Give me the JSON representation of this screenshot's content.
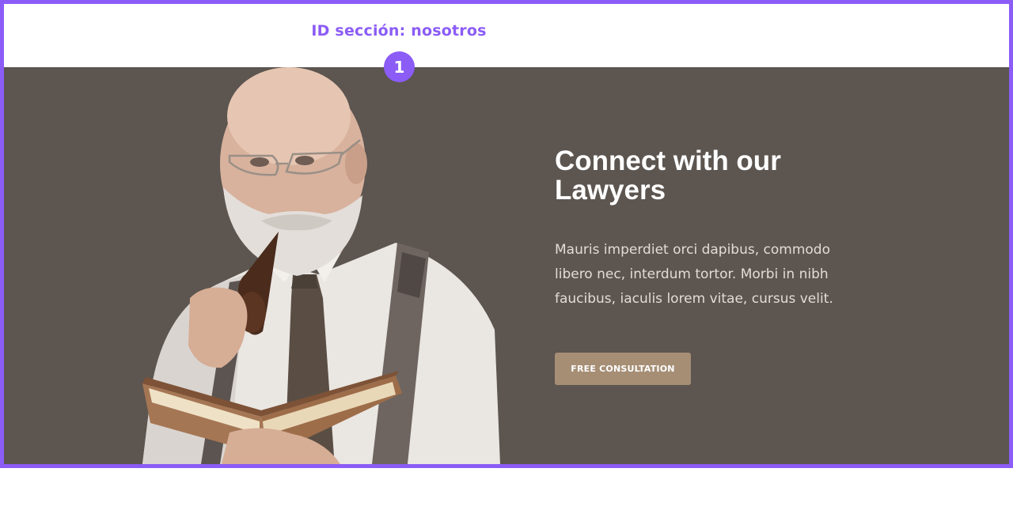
{
  "annotation": {
    "label": "ID sección: nosotros",
    "badge": "1",
    "accent_color": "#8b5cf6"
  },
  "hero": {
    "background_color": "#5c5550",
    "headline": "Connect with our Lawyers",
    "lead": "Mauris imperdiet orci dapibus, commodo libero nec, interdum tortor. Morbi in nibh faucibus, iaculis lorem vitae, cursus velit.",
    "cta_label": "FREE CONSULTATION",
    "cta_color": "#a68e75",
    "image": "lawyer-portrait-with-book-and-pipe"
  }
}
